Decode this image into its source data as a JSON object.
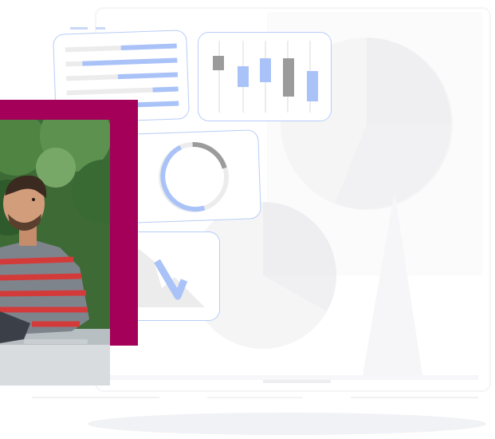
{
  "colors": {
    "accent_blue": "#a9c2f8",
    "card_border": "#b7cdf7",
    "neutral_gray": "#9b9b9b",
    "light_gray": "#ececec",
    "magenta": "#a4005a"
  },
  "icons": {
    "bar_card": "horizontal-bar-chart-icon",
    "candle_card": "candlestick-chart-icon",
    "donut_card": "donut-chart-icon",
    "trend_card": "area-trend-chart-icon",
    "background": "pie-chart-illustration",
    "photo": "man-with-laptop-photo"
  },
  "illustration": {
    "bar_fill_fractions": [
      0.5,
      0.85,
      0.55,
      0.2,
      0.6
    ],
    "donut_progress": 0.55
  }
}
